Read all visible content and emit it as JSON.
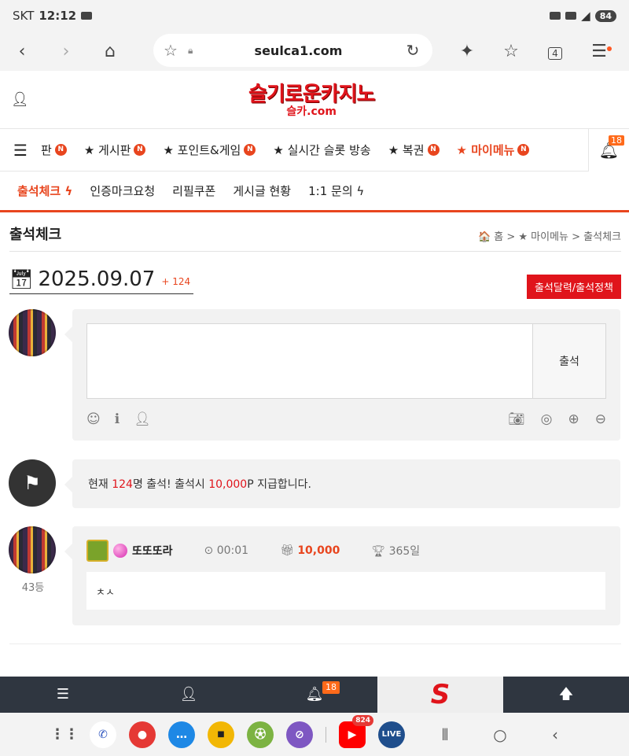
{
  "statusbar": {
    "carrier": "SKT",
    "time": "12:12",
    "battery": "84"
  },
  "browser": {
    "url": "seulca1.com",
    "back_icon": "‹",
    "forward_icon": "›",
    "home_icon": "⌂",
    "tabs_count": "4"
  },
  "site": {
    "logo_main": "슬기로운카지노",
    "logo_sub": "슬카.com"
  },
  "mainnav": {
    "items": [
      {
        "label": "판",
        "badge": "N"
      },
      {
        "label": "★ 게시판",
        "badge": "N"
      },
      {
        "label": "★ 포인트&게임",
        "badge": "N"
      },
      {
        "label": "★ 실시간 슬롯 방송",
        "badge": ""
      },
      {
        "label": "★ 복권",
        "badge": "N"
      },
      {
        "label": "★ 마이메뉴",
        "badge": "N"
      }
    ],
    "notif_count": "18"
  },
  "subnav": {
    "items": [
      "출석체크 ϟ",
      "인증마크요청",
      "리필쿠폰",
      "게시글 현황",
      "1:1 문의 ϟ"
    ]
  },
  "page": {
    "title": "출석체크",
    "breadcrumb": "🏠 홈 > ★ 마이메뉴 > 출석체크",
    "date": "2025.09.07",
    "date_count": "+ 124",
    "policy_button": "출석달력/출석정책"
  },
  "form": {
    "submit_label": "출석"
  },
  "notice": {
    "prefix": "현재 ",
    "count": "124",
    "middle": "명 출석! 출석시 ",
    "points": "10,000",
    "suffix": "P 지급합니다."
  },
  "entry": {
    "username": "또또또라",
    "time": "00:01",
    "points": "10,000",
    "days": "365일",
    "body": "ㅊㅅ",
    "rank": "43등"
  },
  "bottomnav": {
    "notif_count": "18",
    "logo": "S"
  },
  "android": {
    "youtube_badge": "824",
    "live_label": "LIVE score"
  }
}
